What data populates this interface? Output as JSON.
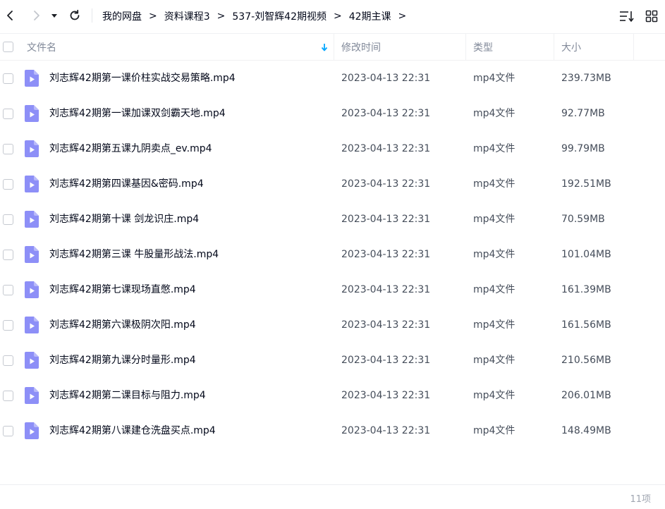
{
  "breadcrumb": [
    {
      "label": "我的网盘"
    },
    {
      "label": "资料课程3"
    },
    {
      "label": "537-刘智辉42期视频"
    },
    {
      "label": "42期主课"
    }
  ],
  "breadcrumb_separator": ">",
  "columns": {
    "name": "文件名",
    "modified": "修改时间",
    "type": "类型",
    "size": "大小"
  },
  "files": [
    {
      "name": "刘志辉42期第一课价柱实战交易策略.mp4",
      "modified": "2023-04-13 22:31",
      "type": "mp4文件",
      "size": "239.73MB"
    },
    {
      "name": "刘志辉42期第一课加课双剑霸天地.mp4",
      "modified": "2023-04-13 22:31",
      "type": "mp4文件",
      "size": "92.77MB"
    },
    {
      "name": "刘志辉42期第五课九阴卖点_ev.mp4",
      "modified": "2023-04-13 22:31",
      "type": "mp4文件",
      "size": "99.79MB"
    },
    {
      "name": "刘志辉42期第四课基因&密码.mp4",
      "modified": "2023-04-13 22:31",
      "type": "mp4文件",
      "size": "192.51MB"
    },
    {
      "name": "刘志辉42期第十课 剑龙识庄.mp4",
      "modified": "2023-04-13 22:31",
      "type": "mp4文件",
      "size": "70.59MB"
    },
    {
      "name": "刘志辉42期第三课 牛股量形战法.mp4",
      "modified": "2023-04-13 22:31",
      "type": "mp4文件",
      "size": "101.04MB"
    },
    {
      "name": "刘志辉42期第七课现场直憋.mp4",
      "modified": "2023-04-13 22:31",
      "type": "mp4文件",
      "size": "161.39MB"
    },
    {
      "name": "刘志辉42期第六课极阴次阳.mp4",
      "modified": "2023-04-13 22:31",
      "type": "mp4文件",
      "size": "161.56MB"
    },
    {
      "name": "刘志辉42期第九课分时量形.mp4",
      "modified": "2023-04-13 22:31",
      "type": "mp4文件",
      "size": "210.56MB"
    },
    {
      "name": "刘志辉42期第二课目标与阻力.mp4",
      "modified": "2023-04-13 22:31",
      "type": "mp4文件",
      "size": "206.01MB"
    },
    {
      "name": "刘志辉42期第八课建仓洗盘买点.mp4",
      "modified": "2023-04-13 22:31",
      "type": "mp4文件",
      "size": "148.49MB"
    }
  ],
  "item_count": "11项",
  "colors": {
    "video_icon": "#8d8ff7",
    "accent": "#06a7ff"
  },
  "icons": {
    "back": "chevron-left-icon",
    "forward": "chevron-right-icon",
    "dropdown": "caret-down-icon",
    "refresh": "refresh-icon",
    "sort": "sort-icon",
    "view": "grid-view-icon",
    "sort_direction": "arrow-down-icon",
    "file": "video-file-icon"
  }
}
